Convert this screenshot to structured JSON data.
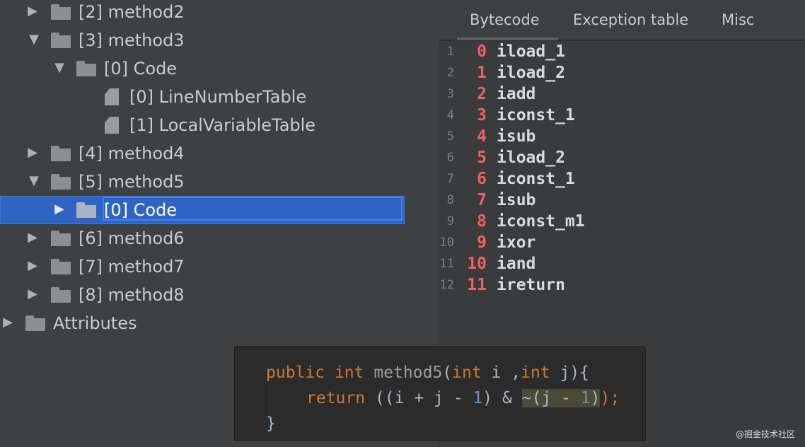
{
  "tree": {
    "rows": [
      {
        "label": "[2] method2",
        "expanded": false,
        "icon": "folder-icon"
      },
      {
        "label": "[3] method3",
        "expanded": true,
        "icon": "folder-icon"
      },
      {
        "label": "[0] Code",
        "expanded": true,
        "icon": "folder-icon"
      },
      {
        "label": "[0] LineNumberTable",
        "icon": "file-icon"
      },
      {
        "label": "[1] LocalVariableTable",
        "icon": "file-icon"
      },
      {
        "label": "[4] method4",
        "expanded": false,
        "icon": "folder-icon"
      },
      {
        "label": "[5] method5",
        "expanded": true,
        "icon": "folder-icon"
      },
      {
        "label": "[0] Code",
        "expanded": false,
        "icon": "folder-icon",
        "selected": true
      },
      {
        "label": "[6] method6",
        "expanded": false,
        "icon": "folder-icon"
      },
      {
        "label": "[7] method7",
        "expanded": false,
        "icon": "folder-icon"
      },
      {
        "label": "[8] method8",
        "expanded": false,
        "icon": "folder-icon"
      },
      {
        "label": "Attributes",
        "expanded": false,
        "icon": "folder-icon"
      }
    ]
  },
  "tabs": {
    "bytecode": "Bytecode",
    "exception_table": "Exception table",
    "misc": "Misc",
    "active": "Bytecode"
  },
  "bytecode": [
    {
      "line": "1",
      "offset": "0",
      "instr": "iload_1"
    },
    {
      "line": "2",
      "offset": "1",
      "instr": "iload_2"
    },
    {
      "line": "3",
      "offset": "2",
      "instr": "iadd"
    },
    {
      "line": "4",
      "offset": "3",
      "instr": "iconst_1"
    },
    {
      "line": "5",
      "offset": "4",
      "instr": "isub"
    },
    {
      "line": "6",
      "offset": "5",
      "instr": "iload_2"
    },
    {
      "line": "7",
      "offset": "6",
      "instr": "iconst_1"
    },
    {
      "line": "8",
      "offset": "7",
      "instr": "isub"
    },
    {
      "line": "9",
      "offset": "8",
      "instr": "iconst_m1"
    },
    {
      "line": "10",
      "offset": "9",
      "instr": "ixor"
    },
    {
      "line": "11",
      "offset": "10",
      "instr": "iand"
    },
    {
      "line": "12",
      "offset": "11",
      "instr": "ireturn"
    }
  ],
  "source": {
    "l1": {
      "kw1": "public",
      "kw2": "int",
      "fn": "method5",
      "p1": "(",
      "kw3": "int",
      "a1": " i ,",
      "kw4": "int",
      "a2": " j){"
    },
    "l2": {
      "kw": "return",
      "a": " ((i + j - ",
      "n1": "1",
      "b": ") & ",
      "hl_a": "~(j - ",
      "n2": "1",
      "hl_b": ")",
      "c": ");"
    },
    "l3": "}"
  },
  "watermark": "@掘金技术社区",
  "colors": {
    "selection": "#2f64c3",
    "offset": "#f06060",
    "keyword": "#cc7832"
  }
}
